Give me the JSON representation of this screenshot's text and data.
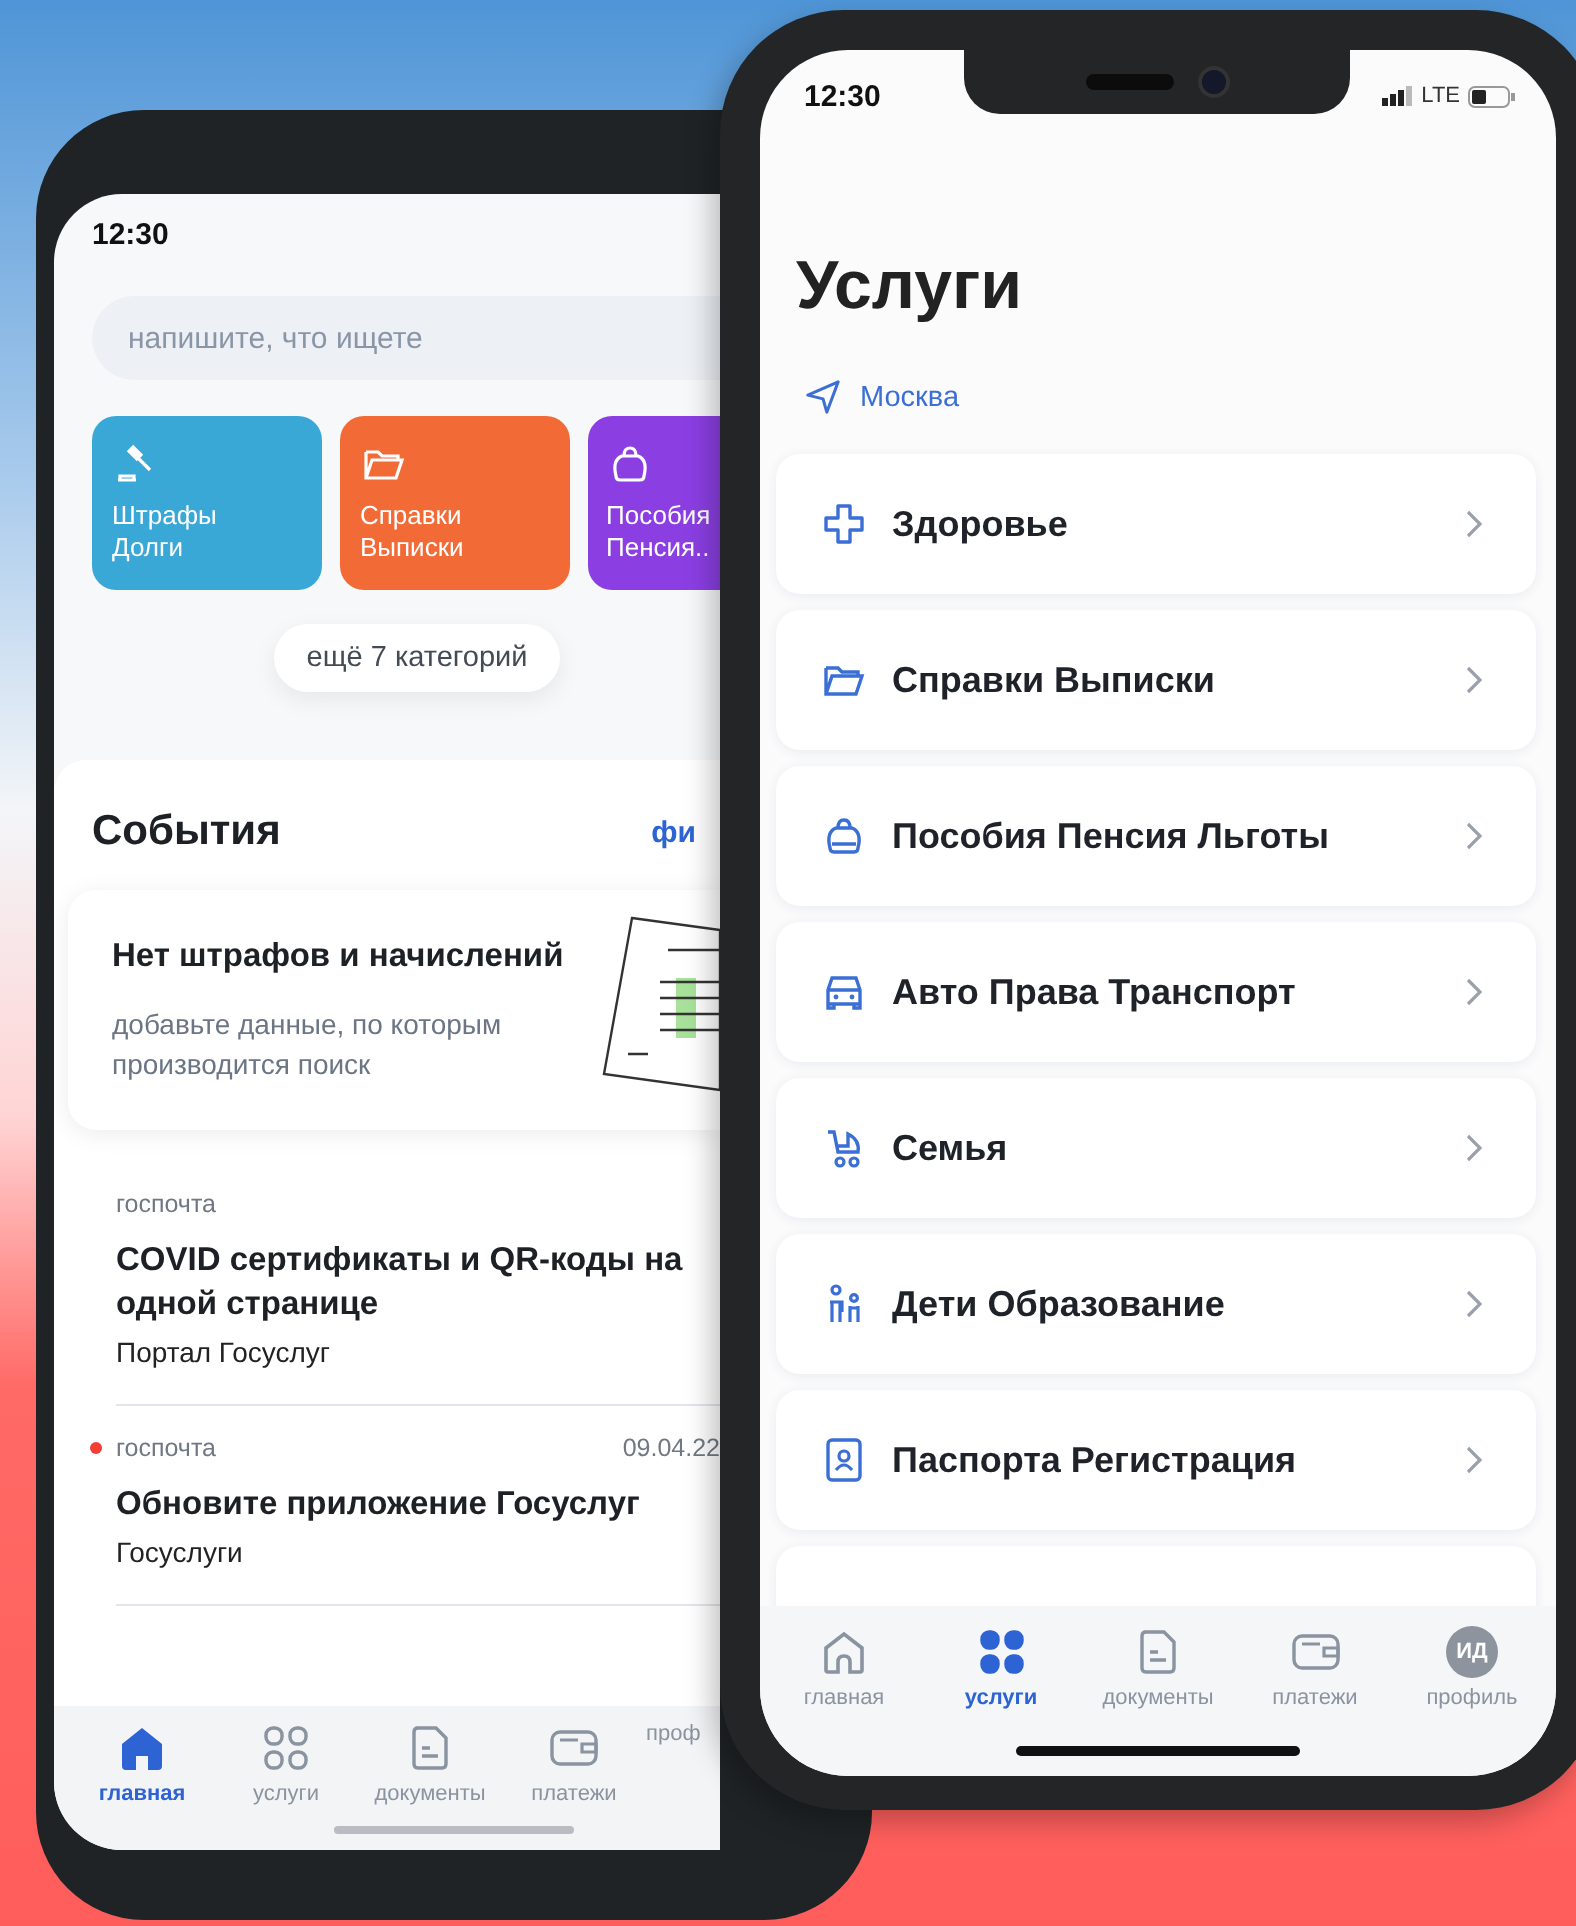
{
  "left_phone": {
    "status_time": "12:30",
    "search": {
      "placeholder": "напишите, что ищете"
    },
    "categories": [
      {
        "label": "Штрафы\nДолги",
        "color": "#3aa8d6"
      },
      {
        "label": "Справки\nВыписки",
        "color": "#f26b36"
      },
      {
        "label": "Пособия\nПенсия..",
        "color": "#8b3fe3"
      }
    ],
    "more_button": "ещё 7 категорий",
    "events": {
      "title": "События",
      "link": "фи",
      "notice": {
        "title": "Нет штрафов и начислений",
        "text": "добавьте данные, по которым производится поиск"
      },
      "news": [
        {
          "source": "госпочта",
          "unread": false,
          "title": "COVID сертификаты и QR-коды на одной странице",
          "author": "Портал Госуслуг"
        },
        {
          "source": "госпочта",
          "unread": true,
          "date": "09.04.22",
          "title": "Обновите приложение Госуслуг",
          "author": "Госуслуги"
        }
      ]
    },
    "tab_bar": [
      {
        "label": "главная",
        "selected": true
      },
      {
        "label": "услуги",
        "selected": false
      },
      {
        "label": "документы",
        "selected": false
      },
      {
        "label": "платежи",
        "selected": false
      },
      {
        "label": "проф",
        "selected": false
      }
    ]
  },
  "right_phone": {
    "status_time": "12:30",
    "network": "LTE",
    "title": "Услуги",
    "location": "Москва",
    "services": [
      {
        "label": "Здоровье"
      },
      {
        "label": "Справки Выписки"
      },
      {
        "label": "Пособия Пенсия Льготы"
      },
      {
        "label": "Авто Права Транспорт"
      },
      {
        "label": "Семья"
      },
      {
        "label": "Дети Образование"
      },
      {
        "label": "Паспорта Регистрация"
      }
    ],
    "tab_bar": [
      {
        "label": "главная",
        "selected": false
      },
      {
        "label": "услуги",
        "selected": true
      },
      {
        "label": "документы",
        "selected": false
      },
      {
        "label": "платежи",
        "selected": false
      },
      {
        "label": "профиль",
        "selected": false,
        "avatar": "ИД"
      }
    ]
  }
}
